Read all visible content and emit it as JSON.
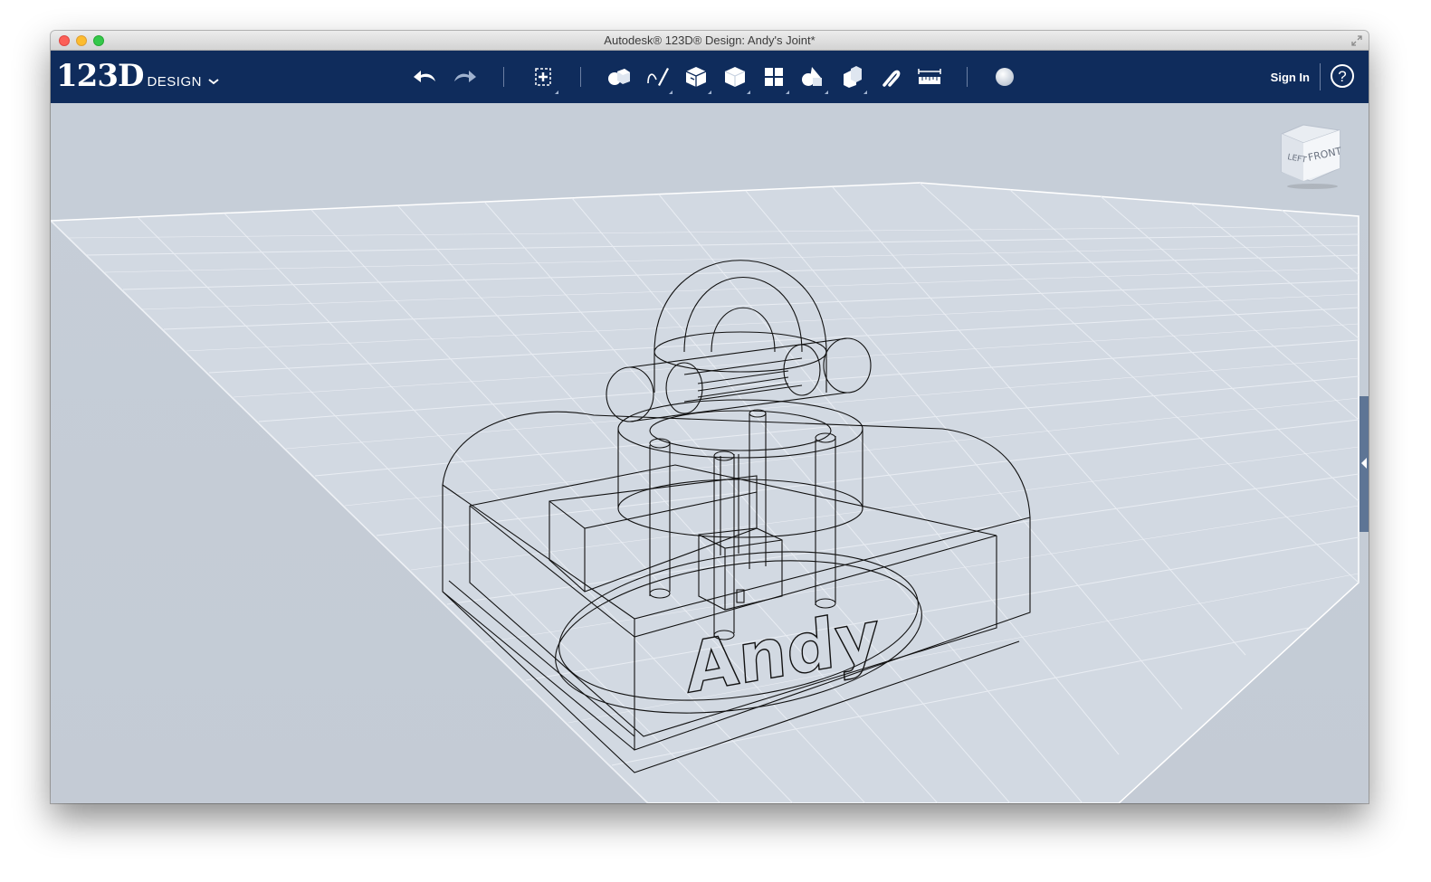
{
  "window": {
    "title": "Autodesk® 123D® Design: Andy's Joint*"
  },
  "toolbar": {
    "logo_main": "123D",
    "logo_sub": "DESIGN",
    "sign_in": "Sign In",
    "help": "?",
    "tools": [
      {
        "name": "undo",
        "icon": "undo-icon"
      },
      {
        "name": "redo",
        "icon": "redo-icon"
      },
      {
        "name": "transform",
        "icon": "transform-icon"
      },
      {
        "name": "primitives",
        "icon": "primitives-icon"
      },
      {
        "name": "sketch",
        "icon": "sketch-icon"
      },
      {
        "name": "construct",
        "icon": "construct-icon"
      },
      {
        "name": "modify",
        "icon": "modify-icon"
      },
      {
        "name": "pattern",
        "icon": "pattern-icon"
      },
      {
        "name": "grouping",
        "icon": "grouping-icon"
      },
      {
        "name": "combine",
        "icon": "combine-icon"
      },
      {
        "name": "snap",
        "icon": "snap-icon"
      },
      {
        "name": "measure",
        "icon": "measure-icon"
      },
      {
        "name": "material",
        "icon": "material-icon"
      }
    ]
  },
  "viewport": {
    "viewcube_left": "LEFT",
    "viewcube_front": "FRONT",
    "model_text": "Andy",
    "background_color": "#c5ccd6",
    "grid_color": "#e8edf3"
  }
}
